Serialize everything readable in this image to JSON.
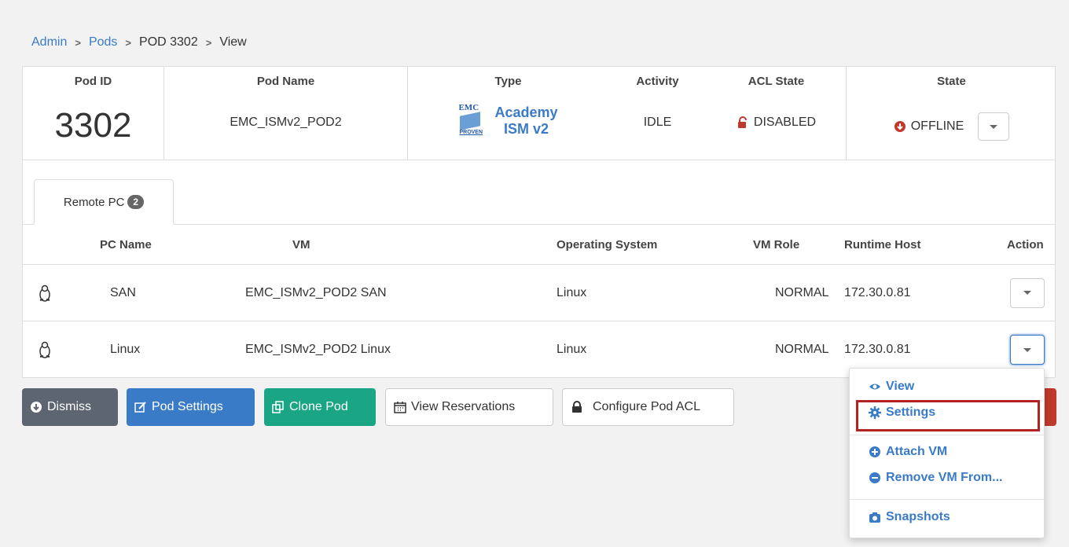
{
  "breadcrumb": {
    "admin": "Admin",
    "pods": "Pods",
    "pod": "POD 3302",
    "view": "View"
  },
  "summary": {
    "pod_id_label": "Pod ID",
    "pod_id": "3302",
    "pod_name_label": "Pod Name",
    "pod_name": "EMC_ISMv2_POD2",
    "type_label": "Type",
    "type_logo_top": "EMC",
    "type_logo_bottom": "PROVEN",
    "type_line1": "Academy",
    "type_line2": "ISM v2",
    "activity_label": "Activity",
    "activity": "IDLE",
    "acl_label": "ACL State",
    "acl": "DISABLED",
    "state_label": "State",
    "state": "OFFLINE"
  },
  "tabs": {
    "remote_pc_label": "Remote PC",
    "remote_pc_count": "2"
  },
  "table": {
    "headers": [
      "PC Name",
      "VM",
      "Operating System",
      "VM Role",
      "Runtime Host",
      "Action"
    ],
    "rows": [
      {
        "pc_name": "SAN",
        "vm": "EMC_ISMv2_POD2 SAN",
        "os": "Linux",
        "role": "NORMAL",
        "host": "172.30.0.81"
      },
      {
        "pc_name": "Linux",
        "vm": "EMC_ISMv2_POD2 Linux",
        "os": "Linux",
        "role": "NORMAL",
        "host": "172.30.0.81"
      }
    ]
  },
  "buttons": {
    "dismiss": "Dismiss",
    "pod_settings": "Pod Settings",
    "clone_pod": "Clone Pod",
    "view_reservations": "View Reservations",
    "configure_acl": "Configure Pod ACL"
  },
  "menu": {
    "view": "View",
    "settings": "Settings",
    "attach_vm": "Attach VM",
    "remove_vm": "Remove VM From...",
    "snapshots": "Snapshots"
  },
  "colors": {
    "link": "#3a7bc8",
    "green": "#1aa684",
    "dark": "#5d6670",
    "danger": "#c0392b",
    "highlight": "#b22222"
  }
}
